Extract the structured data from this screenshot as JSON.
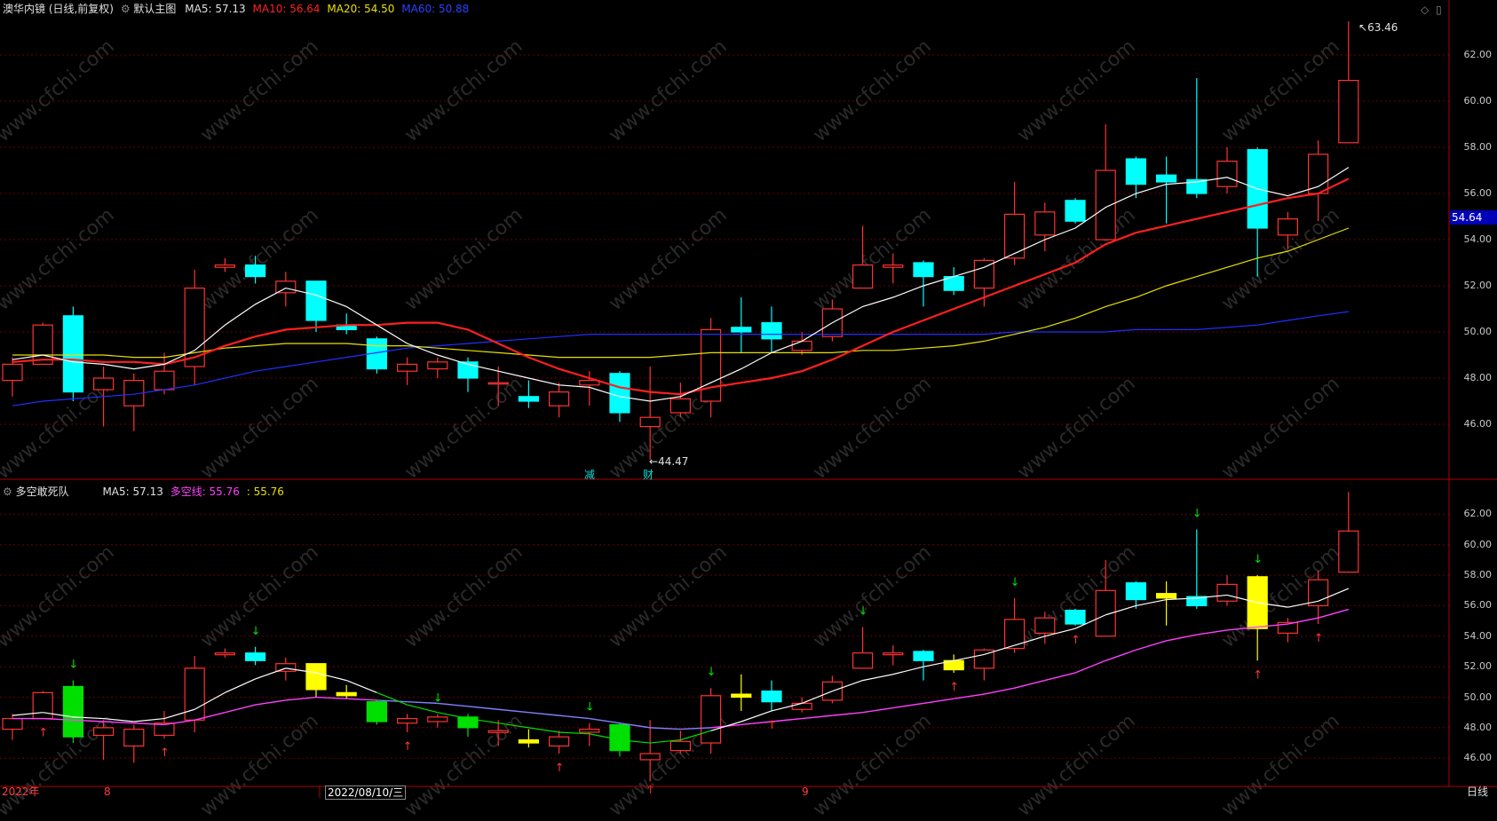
{
  "main_header": {
    "title": "澳华内镜 (日线,前复权)",
    "indicator": "默认主图",
    "ma5": "MA5: 57.13",
    "ma10": "MA10: 56.64",
    "ma20": "MA20: 54.50",
    "ma60": "MA60: 50.88"
  },
  "sub_header": {
    "title": "多空敢死队",
    "ma5": "MA5: 57.13",
    "dkx": "多空线: 55.76",
    "other": ": 55.76"
  },
  "price_axis": [
    "62.00",
    "60.00",
    "58.00",
    "56.00",
    "54.00",
    "52.00",
    "50.00",
    "48.00",
    "46.00"
  ],
  "sub_axis": [
    "62.00",
    "60.00",
    "58.00",
    "56.00",
    "54.00",
    "52.00",
    "50.00",
    "48.00",
    "46.00"
  ],
  "current_price_tag": "54.64",
  "high_label": "63.46",
  "low_label": "44.47",
  "markers": {
    "reduce": "减",
    "finance": "财"
  },
  "date_axis": {
    "year": "2022年",
    "m8": "8",
    "cursor_date": "2022/08/10/三",
    "m9": "9",
    "period": "日线"
  },
  "watermark": "www.cfchi.com",
  "colors": {
    "up": "#ff3232",
    "down": "#00ffff",
    "ma5": "#ffffff",
    "ma10": "#ff2020",
    "ma20": "#e8e000",
    "ma60": "#2030ff",
    "dkx": "#ff40ff",
    "green": "#00e000",
    "yellow": "#ffff00"
  },
  "chart_data": [
    {
      "type": "candlestick",
      "title": "澳华内镜 (日线,前复权)",
      "ylim": [
        44,
        64
      ],
      "candles": [
        [
          47.9,
          48.6,
          47.2,
          48.9
        ],
        [
          48.6,
          50.3,
          48.6,
          50.4
        ],
        [
          50.7,
          47.4,
          47.0,
          51.1
        ],
        [
          47.5,
          48.0,
          45.9,
          48.5
        ],
        [
          46.8,
          47.9,
          45.7,
          48.2
        ],
        [
          47.5,
          48.3,
          47.3,
          49.1
        ],
        [
          48.5,
          51.9,
          47.7,
          52.7
        ],
        [
          52.8,
          52.9,
          52.6,
          53.2
        ],
        [
          52.9,
          52.4,
          52.1,
          53.3
        ],
        [
          51.7,
          52.2,
          51.1,
          52.6
        ],
        [
          52.2,
          50.5,
          50.0,
          52.2
        ],
        [
          50.3,
          50.1,
          49.9,
          50.8
        ],
        [
          49.7,
          48.4,
          48.2,
          49.8
        ],
        [
          48.3,
          48.6,
          47.7,
          48.9
        ],
        [
          48.4,
          48.7,
          48.0,
          48.9
        ],
        [
          48.7,
          48.0,
          47.4,
          48.9
        ],
        [
          47.8,
          47.8,
          46.8,
          48.5
        ],
        [
          47.2,
          47.0,
          46.7,
          47.9
        ],
        [
          46.8,
          47.4,
          46.3,
          47.8
        ],
        [
          47.7,
          47.9,
          46.8,
          48.3
        ],
        [
          48.2,
          46.5,
          46.1,
          48.3
        ],
        [
          45.9,
          46.3,
          44.47,
          48.5
        ],
        [
          46.5,
          47.1,
          46.3,
          47.8
        ],
        [
          47.0,
          50.1,
          46.3,
          50.6
        ],
        [
          50.2,
          50.0,
          49.1,
          51.5
        ],
        [
          50.4,
          49.7,
          49.1,
          51.1
        ],
        [
          49.2,
          49.6,
          49.0,
          50.0
        ],
        [
          49.8,
          51.0,
          49.6,
          51.4
        ],
        [
          51.9,
          52.9,
          51.9,
          54.6
        ],
        [
          52.8,
          52.9,
          52.1,
          53.4
        ],
        [
          53.0,
          52.4,
          51.1,
          53.1
        ],
        [
          52.4,
          51.8,
          51.6,
          52.8
        ],
        [
          51.9,
          53.1,
          51.1,
          53.2
        ],
        [
          53.2,
          55.1,
          52.9,
          56.5
        ],
        [
          54.2,
          55.2,
          53.5,
          55.6
        ],
        [
          55.7,
          54.8,
          54.7,
          55.8
        ],
        [
          54.0,
          57.0,
          54.0,
          59.0
        ],
        [
          57.5,
          56.4,
          55.8,
          57.6
        ],
        [
          56.8,
          56.5,
          54.7,
          57.6
        ],
        [
          56.6,
          56.0,
          55.8,
          61.0
        ],
        [
          56.3,
          57.4,
          56.0,
          58.0
        ],
        [
          57.9,
          54.5,
          52.4,
          58.0
        ],
        [
          54.2,
          54.9,
          53.6,
          55.2
        ],
        [
          56.0,
          57.7,
          54.8,
          58.3
        ],
        [
          58.2,
          60.9,
          58.2,
          63.46
        ]
      ],
      "series": [
        {
          "name": "MA5",
          "values": [
            48.8,
            49.0,
            48.7,
            48.6,
            48.4,
            48.6,
            49.2,
            50.3,
            51.2,
            51.9,
            51.6,
            51.1,
            50.3,
            49.5,
            49.0,
            48.6,
            48.3,
            48.0,
            47.7,
            47.6,
            47.2,
            47.0,
            47.2,
            47.8,
            48.4,
            49.1,
            49.6,
            50.4,
            51.1,
            51.5,
            52.0,
            52.4,
            52.8,
            53.4,
            54.0,
            54.5,
            55.4,
            56.0,
            56.4,
            56.5,
            56.7,
            56.2,
            55.9,
            56.3,
            57.13
          ]
        },
        {
          "name": "MA10",
          "values": [
            48.7,
            48.8,
            48.8,
            48.7,
            48.7,
            48.6,
            48.9,
            49.4,
            49.8,
            50.1,
            50.2,
            50.3,
            50.3,
            50.4,
            50.4,
            50.1,
            49.5,
            48.9,
            48.4,
            48.0,
            47.6,
            47.4,
            47.3,
            47.6,
            47.8,
            48.0,
            48.3,
            48.8,
            49.4,
            50.0,
            50.5,
            51.0,
            51.5,
            52.0,
            52.5,
            53.0,
            53.8,
            54.3,
            54.6,
            54.9,
            55.2,
            55.5,
            55.8,
            56.0,
            56.64
          ]
        },
        {
          "name": "MA20",
          "values": [
            49.0,
            49.0,
            49.0,
            49.0,
            48.9,
            48.9,
            49.1,
            49.3,
            49.4,
            49.5,
            49.5,
            49.5,
            49.4,
            49.4,
            49.3,
            49.2,
            49.1,
            49.0,
            48.9,
            48.9,
            48.9,
            48.9,
            49.0,
            49.1,
            49.1,
            49.1,
            49.1,
            49.1,
            49.2,
            49.2,
            49.3,
            49.4,
            49.6,
            49.9,
            50.2,
            50.6,
            51.1,
            51.5,
            52.0,
            52.4,
            52.8,
            53.2,
            53.5,
            54.0,
            54.5
          ]
        },
        {
          "name": "MA60",
          "values": [
            46.8,
            47.0,
            47.1,
            47.2,
            47.3,
            47.5,
            47.7,
            48.0,
            48.3,
            48.5,
            48.7,
            48.9,
            49.1,
            49.3,
            49.4,
            49.5,
            49.6,
            49.7,
            49.8,
            49.9,
            49.9,
            49.9,
            49.9,
            49.9,
            49.9,
            49.9,
            49.9,
            49.9,
            49.9,
            49.9,
            49.9,
            49.9,
            49.9,
            50.0,
            50.0,
            50.0,
            50.0,
            50.1,
            50.1,
            50.1,
            50.2,
            50.3,
            50.5,
            50.7,
            50.88
          ]
        }
      ]
    },
    {
      "type": "candlestick",
      "title": "多空敢死队",
      "ylim": [
        44.5,
        64
      ],
      "series": [
        {
          "name": "MA5",
          "values": "same as main MA5"
        },
        {
          "name": "多空线",
          "values": [
            48.6,
            48.6,
            48.5,
            48.4,
            48.3,
            48.2,
            48.5,
            49.0,
            49.5,
            49.8,
            50.0,
            49.9,
            49.8,
            49.7,
            49.6,
            49.4,
            49.2,
            49.0,
            48.8,
            48.6,
            48.3,
            48.0,
            47.9,
            48.0,
            48.2,
            48.4,
            48.6,
            48.8,
            49.0,
            49.3,
            49.6,
            49.9,
            50.2,
            50.6,
            51.1,
            51.6,
            52.4,
            53.1,
            53.7,
            54.1,
            54.4,
            54.6,
            54.8,
            55.2,
            55.76
          ]
        }
      ]
    }
  ]
}
